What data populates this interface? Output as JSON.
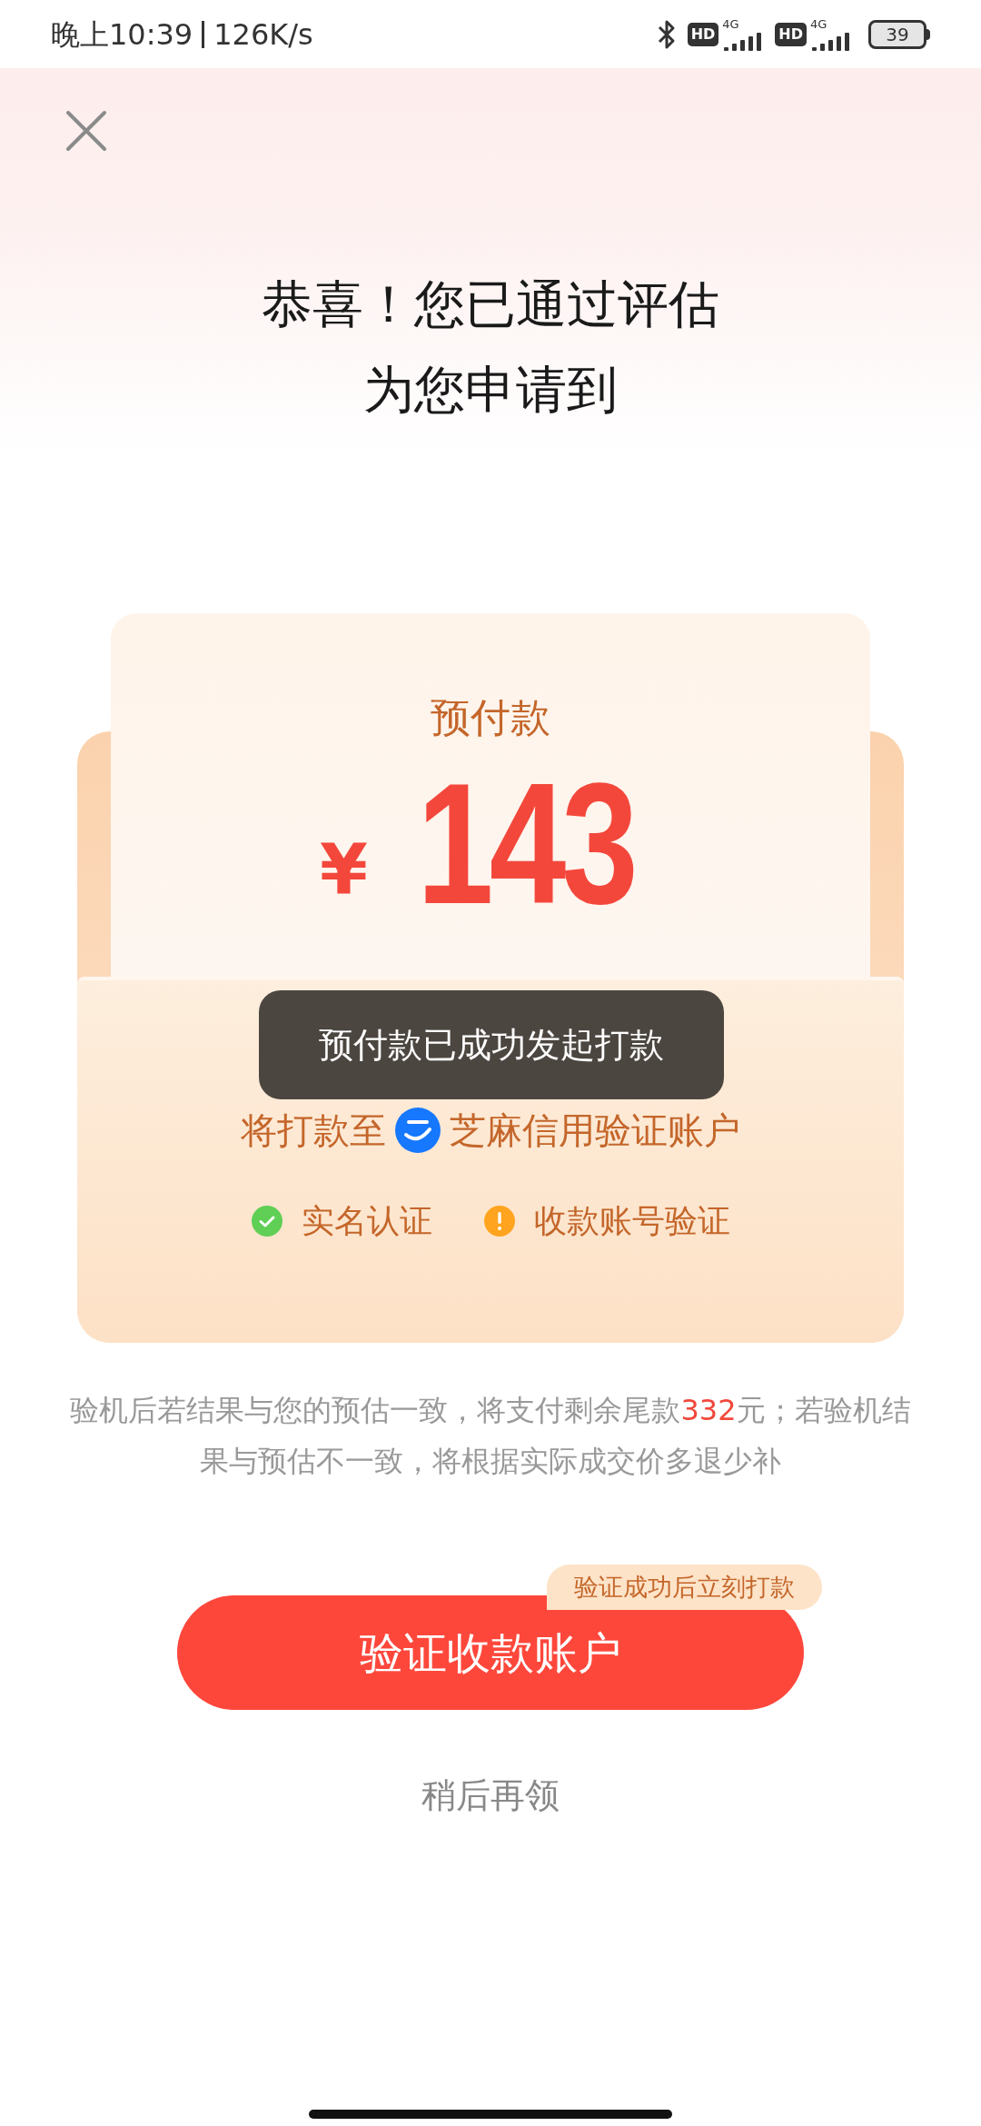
{
  "status_bar": {
    "time": "晚上10:39",
    "speed": "126K/s",
    "sims": [
      {
        "badge": "HD",
        "network": "4G"
      },
      {
        "badge": "HD",
        "network": "4G"
      }
    ],
    "battery": "39"
  },
  "header": {
    "title_lines": [
      "恭喜！您已通过评估",
      "为您申请到"
    ]
  },
  "card": {
    "label": "预付款",
    "currency": "¥",
    "amount": "143",
    "payee_prefix": "将打款至",
    "payee_account": "芝麻信用验证账户",
    "checks": [
      {
        "label": "实名认证",
        "kind": "done"
      },
      {
        "label": "收款账号验证",
        "kind": "pending"
      }
    ]
  },
  "toast": "预付款已成功发起打款",
  "notice": [
    {
      "text": "验机后若结果与您的预估一致，将支付剩余尾款",
      "highlight": false
    },
    {
      "text": "332",
      "highlight": true
    },
    {
      "text": "元；若验机结果与预估不一致，将根据实际成交价多退少补",
      "highlight": false
    }
  ],
  "primary_button": {
    "label": "验证收款账户",
    "badge": "验证成功后立刻打款"
  },
  "secondary_link": "稍后再领"
}
